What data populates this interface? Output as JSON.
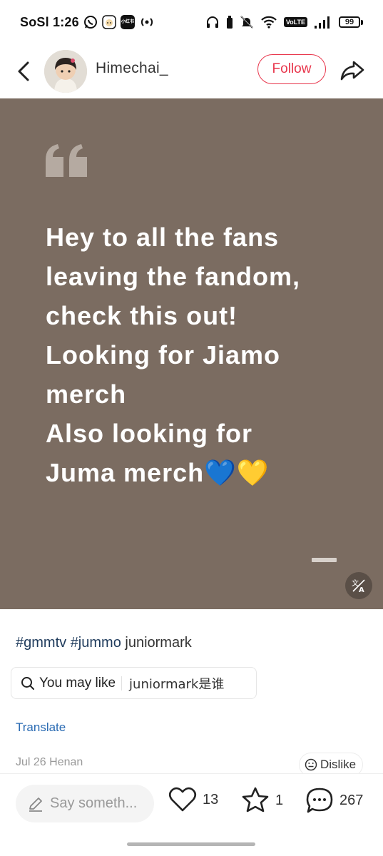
{
  "status_bar": {
    "carrier_time": "SoSl 1:26",
    "app_badge_text": "小红书",
    "volte": "VoLTE",
    "battery": "99"
  },
  "header": {
    "username": "Himechai_",
    "follow_label": "Follow"
  },
  "post": {
    "background_color": "#7b6c61",
    "text": "Hey to all the fans\nleaving the fandom,\ncheck this out!\nLooking for Jiamo\nmerch\nAlso looking for\nJuma merch💙💛"
  },
  "tags": {
    "tag1": "#gmmtv",
    "tag2": "#jummo",
    "plain": "juniormark"
  },
  "you_may_like": {
    "label": "You may like",
    "query": "juniormark是谁"
  },
  "translate_label": "Translate",
  "meta": {
    "date_location": "Jul 26 Henan",
    "dislike_label": "Dislike"
  },
  "bottom_bar": {
    "comment_placeholder": "Say someth...",
    "likes": "13",
    "stars": "1",
    "comments": "267"
  },
  "colors": {
    "accent": "#e8364c",
    "link": "#2a6bb3",
    "tag": "#1f3b5c"
  }
}
